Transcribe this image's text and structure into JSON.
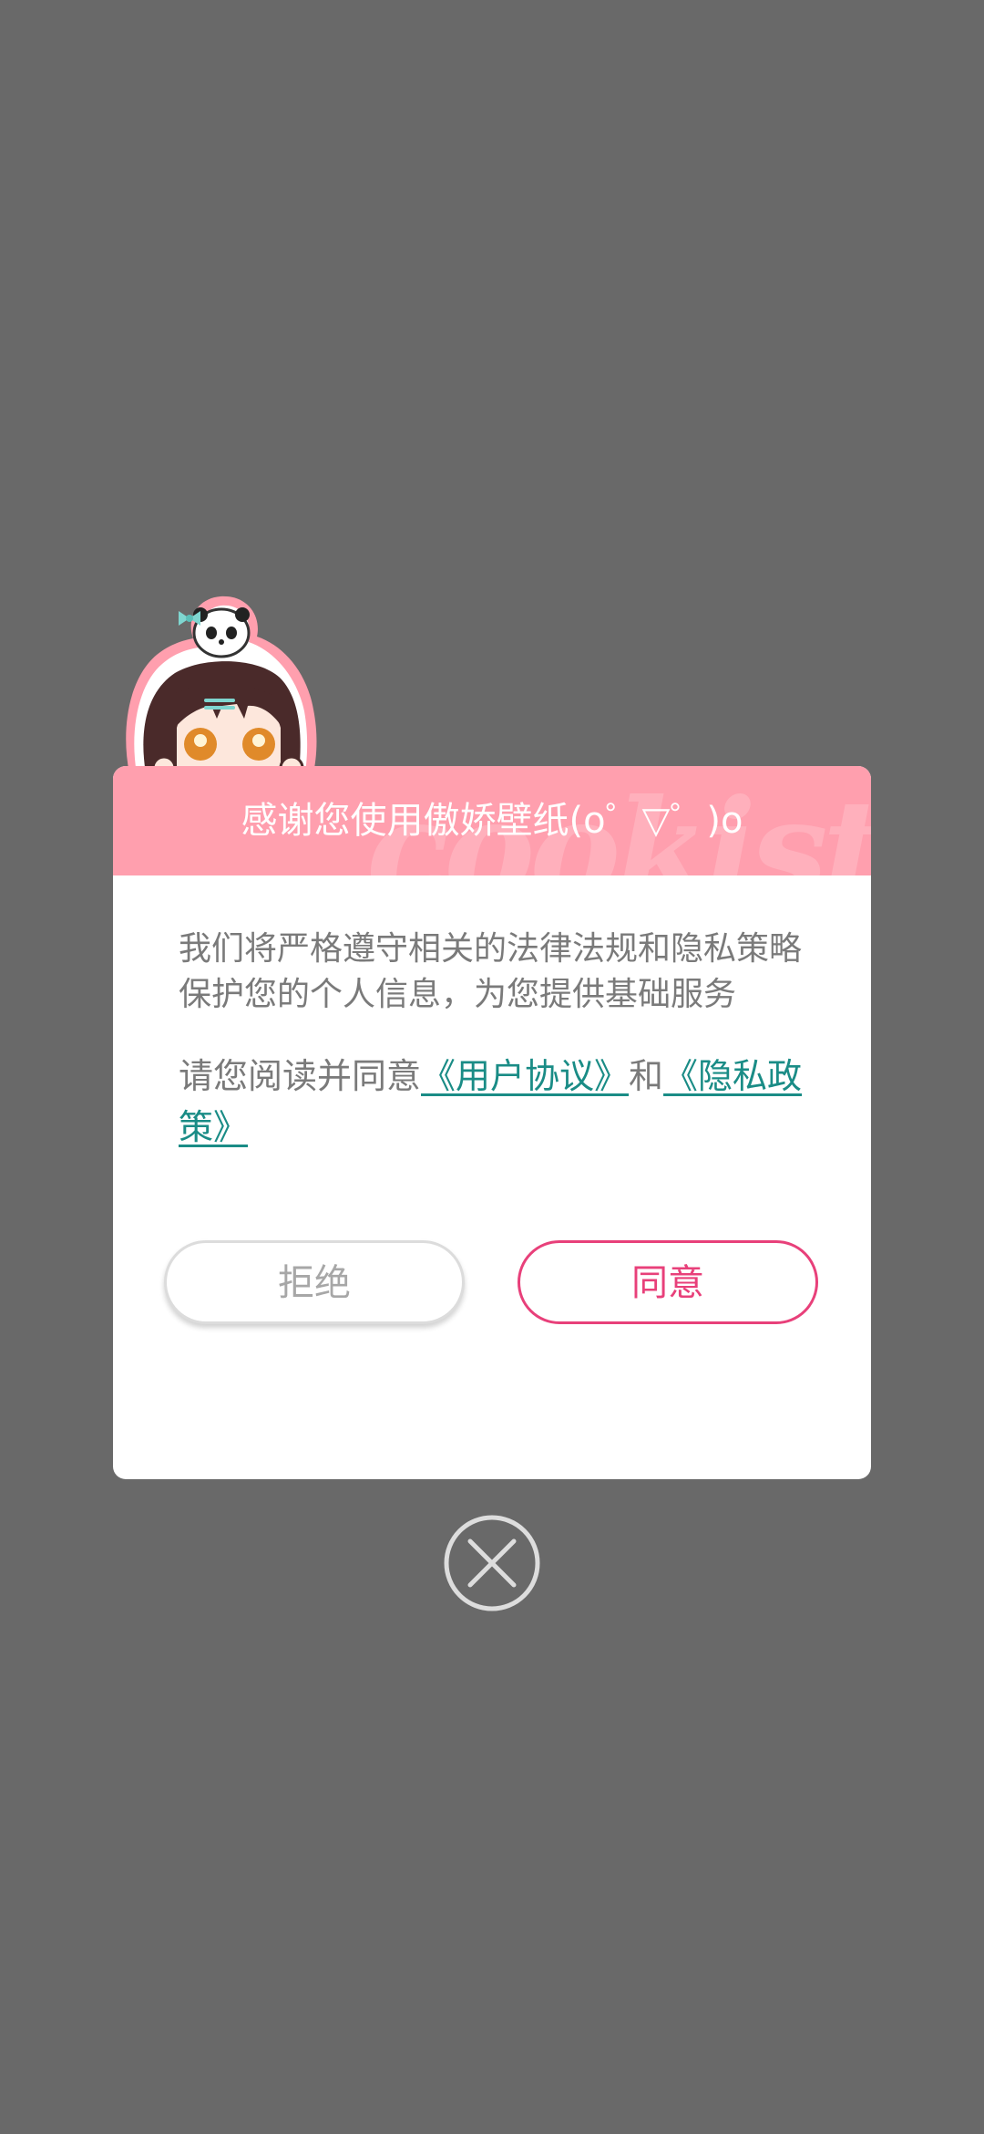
{
  "dialog": {
    "title": "感谢您使用傲娇壁纸(o゜▽゜)o",
    "watermark": "cookist",
    "body_text": "我们将严格遵守相关的法律法规和隐私策略保护您的个人信息，为您提供基础服务",
    "agree_prefix": "请您阅读并同意",
    "user_agreement_link": "《用户协议》",
    "conjunction": "和",
    "privacy_policy_link": "《隐私政策》",
    "reject_label": "拒绝",
    "agree_label": "同意"
  },
  "colors": {
    "overlay": "#696969",
    "header": "#ff9fae",
    "link": "#1a8c86",
    "accent": "#e8407a"
  },
  "icons": {
    "mascot": "mascot-girl-with-panda-icon",
    "close": "close-circle-icon"
  }
}
